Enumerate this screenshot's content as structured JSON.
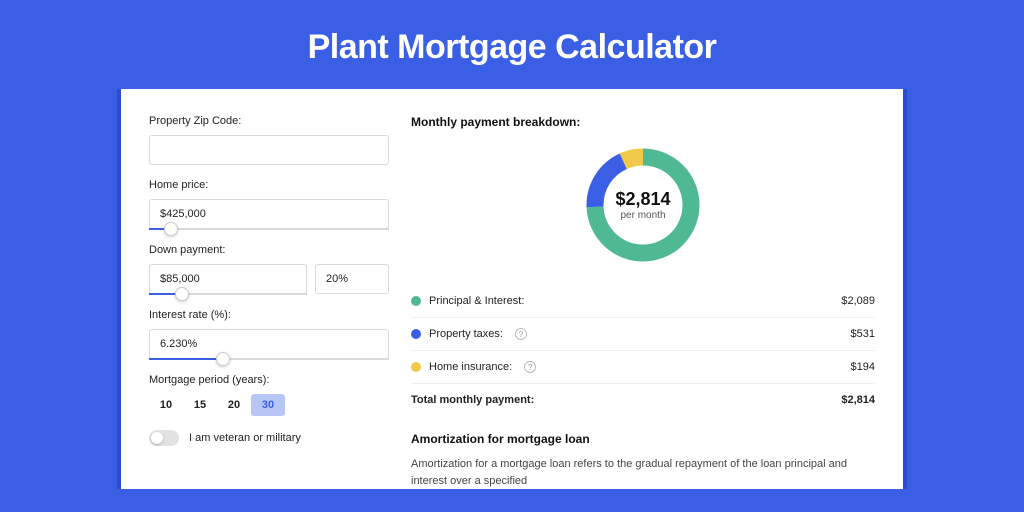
{
  "hero": {
    "title": "Plant Mortgage Calculator"
  },
  "form": {
    "zip": {
      "label": "Property Zip Code:",
      "value": ""
    },
    "price": {
      "label": "Home price:",
      "value": "$425,000",
      "slider_pct": 9
    },
    "down": {
      "label": "Down payment:",
      "amount": "$85,000",
      "percent": "20%",
      "slider_pct": 21
    },
    "rate": {
      "label": "Interest rate (%):",
      "value": "6.230%",
      "slider_pct": 31
    },
    "period": {
      "label": "Mortgage period (years):",
      "options": [
        "10",
        "15",
        "20",
        "30"
      ],
      "active_index": 3
    },
    "veteran": {
      "label": "I am veteran or military",
      "on": false
    }
  },
  "breakdown": {
    "title": "Monthly payment breakdown:",
    "center_amount": "$2,814",
    "center_sub": "per month",
    "items": [
      {
        "label": "Principal & Interest:",
        "value": "$2,089",
        "color": "#4eb993",
        "has_info": false
      },
      {
        "label": "Property taxes:",
        "value": "$531",
        "color": "#3a5fe5",
        "has_info": true
      },
      {
        "label": "Home insurance:",
        "value": "$194",
        "color": "#f0c94a",
        "has_info": true
      }
    ],
    "total": {
      "label": "Total monthly payment:",
      "value": "$2,814"
    }
  },
  "chart_data": {
    "type": "pie",
    "title": "Monthly payment breakdown",
    "series": [
      {
        "name": "Principal & Interest",
        "value": 2089,
        "color": "#4eb993"
      },
      {
        "name": "Property taxes",
        "value": 531,
        "color": "#3a5fe5"
      },
      {
        "name": "Home insurance",
        "value": 194,
        "color": "#f0c94a"
      }
    ],
    "total": 2814,
    "center_label": "$2,814 per month"
  },
  "amort": {
    "title": "Amortization for mortgage loan",
    "body": "Amortization for a mortgage loan refers to the gradual repayment of the loan principal and interest over a specified"
  }
}
